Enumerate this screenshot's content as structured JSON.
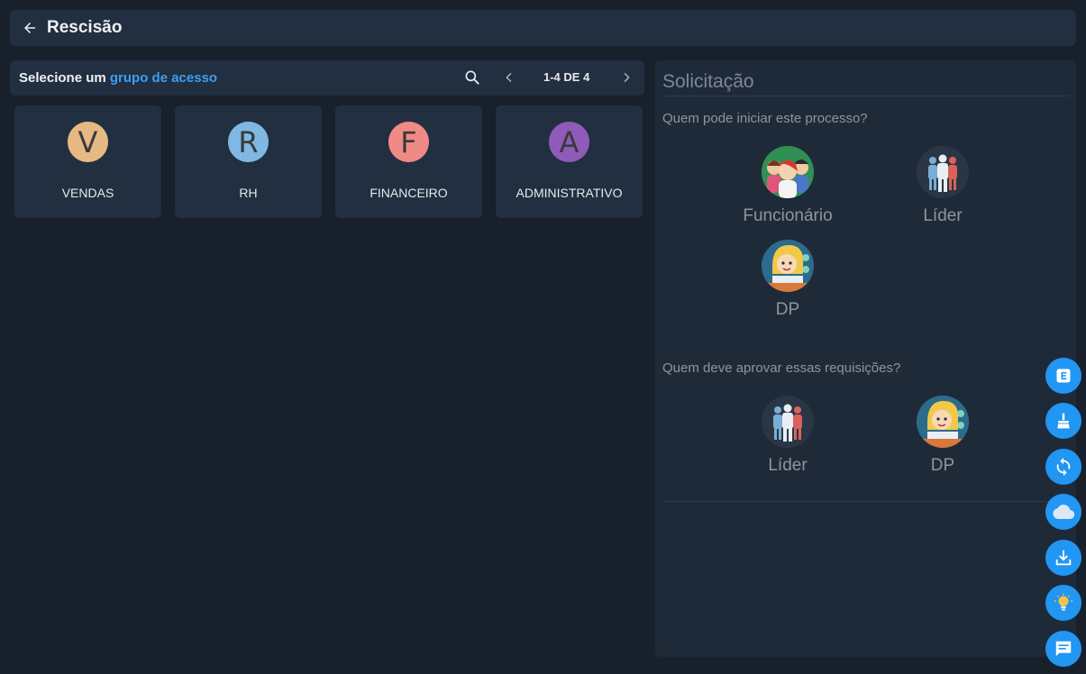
{
  "header": {
    "title": "Rescisão"
  },
  "groups": {
    "label_prefix": "Selecione um",
    "label_highlight": "grupo de acesso",
    "pager": "1-4 DE 4",
    "items": [
      {
        "initial": "V",
        "name": "VENDAS",
        "color": "#e6b883"
      },
      {
        "initial": "R",
        "name": "RH",
        "color": "#7fb8e3"
      },
      {
        "initial": "F",
        "name": "FINANCEIRO",
        "color": "#f08a86"
      },
      {
        "initial": "A",
        "name": "ADMINISTRATIVO",
        "color": "#8e5bb8"
      }
    ]
  },
  "solicitacao": {
    "title": "Solicitação",
    "question_start": "Quem pode iniciar este processo?",
    "starters": [
      "Funcionário",
      "Líder",
      "DP"
    ],
    "question_approve": "Quem deve aprovar essas requisições?",
    "approvers": [
      "Líder",
      "DP"
    ]
  },
  "fab_icons": [
    "e-badge-icon",
    "broom-icon",
    "sync-icon",
    "cloud-icon",
    "download-icon",
    "lightbulb-icon",
    "chat-icon"
  ],
  "colors": {
    "accent": "#3d9ef5",
    "fab": "#2196f3"
  }
}
